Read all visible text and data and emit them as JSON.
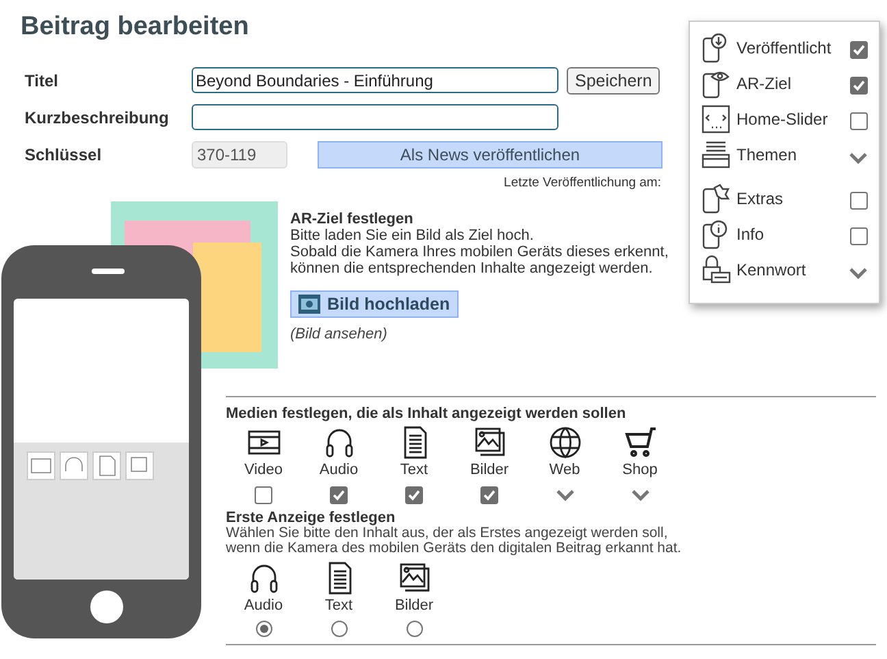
{
  "page_title": "Beitrag bearbeiten",
  "form": {
    "title_label": "Titel",
    "title_value": "Beyond Boundaries - Einführung",
    "save_button": "Speichern",
    "summary_label": "Kurzbeschreibung",
    "key_label": "Schlüssel",
    "key_value": "370-119",
    "publish_news_button": "Als News veröffentlichen",
    "last_published": "Letzte Veröffentlichung am:"
  },
  "ar_target": {
    "heading": "AR-Ziel festlegen",
    "text_lines": [
      "Bitte laden Sie ein Bild als Ziel hoch.",
      "Sobald die Kamera Ihres mobilen Geräts dieses erkennt,",
      "können die entsprechenden Inhalte angezeigt werden."
    ],
    "upload_button": "Bild hochladen",
    "view_link": "(Bild ansehen)"
  },
  "media": {
    "heading": "Medien festlegen, die als Inhalt angezeigt werden sollen",
    "items": [
      {
        "label": "Video",
        "kind": "checkbox",
        "checked": false
      },
      {
        "label": "Audio",
        "kind": "checkbox",
        "checked": true
      },
      {
        "label": "Text",
        "kind": "checkbox",
        "checked": true
      },
      {
        "label": "Bilder",
        "kind": "checkbox",
        "checked": true
      },
      {
        "label": "Web",
        "kind": "dropdown"
      },
      {
        "label": "Shop",
        "kind": "dropdown"
      }
    ]
  },
  "first_display": {
    "heading": "Erste Anzeige festlegen",
    "description_lines": [
      "Wählen Sie bitte den Inhalt aus, der als Erstes angezeigt werden soll,",
      "wenn die Kamera des mobilen Geräts den digitalen Beitrag erkannt hat."
    ],
    "options": [
      {
        "label": "Audio",
        "selected": true
      },
      {
        "label": "Text",
        "selected": false
      },
      {
        "label": "Bilder",
        "selected": false
      }
    ]
  },
  "settings_panel": {
    "items": [
      {
        "label": "Veröffentlicht",
        "kind": "checkbox",
        "checked": true
      },
      {
        "label": "AR-Ziel",
        "kind": "checkbox",
        "checked": true
      },
      {
        "label": "Home-Slider",
        "kind": "checkbox",
        "checked": false
      },
      {
        "label": "Themen",
        "kind": "dropdown"
      },
      {
        "label": "Extras",
        "kind": "checkbox",
        "checked": false
      },
      {
        "label": "Info",
        "kind": "checkbox",
        "checked": false
      },
      {
        "label": "Kennwort",
        "kind": "dropdown"
      }
    ]
  }
}
